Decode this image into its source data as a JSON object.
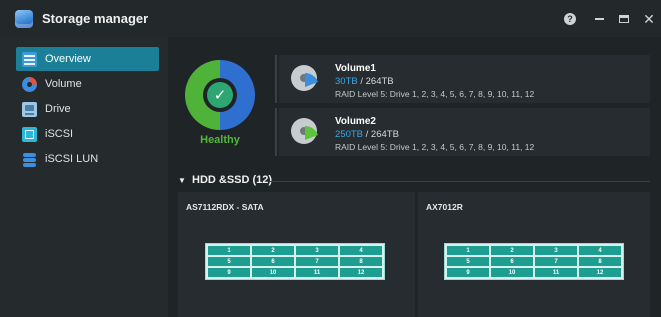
{
  "app": {
    "title": "Storage manager",
    "icon": "storage-app-icon"
  },
  "window_controls": {
    "help_label": "?",
    "close_label": "✕"
  },
  "sidebar": {
    "items": [
      {
        "label": "Overview",
        "icon": "overview-icon",
        "active": true
      },
      {
        "label": "Volume",
        "icon": "volume-icon",
        "active": false
      },
      {
        "label": "Drive",
        "icon": "drive-icon",
        "active": false
      },
      {
        "label": "iSCSI",
        "icon": "iscsi-icon",
        "active": false
      },
      {
        "label": "iSCSI LUN",
        "icon": "iscsi-lun-icon",
        "active": false
      }
    ]
  },
  "status": {
    "label": "Healthy",
    "color": "#50b83c"
  },
  "volumes": [
    {
      "name": "Volume1",
      "used": "30TB",
      "total": " / 264TB",
      "raid": "RAID Level 5: Drive 1, 2, 3, 4, 5, 6, 7, 8, 9, 10, 11, 12",
      "wedge_color": "#3b8de0",
      "used_fraction": 0.11
    },
    {
      "name": "Volume2",
      "used": "250TB",
      "total": " / 264TB",
      "raid": "RAID Level 5: Drive 1, 2, 3, 4, 5, 6, 7, 8, 9, 10, 11, 12",
      "wedge_color": "#5cc43a",
      "used_fraction": 0.95
    }
  ],
  "hdd_section": {
    "title": "HDD &SSD (12)",
    "panels": [
      {
        "title": "AS7112RDX - SATA",
        "slots": [
          "1",
          "2",
          "3",
          "4",
          "5",
          "6",
          "7",
          "8",
          "9",
          "10",
          "11",
          "12"
        ]
      },
      {
        "title": "AX7012R",
        "slots": [
          "1",
          "2",
          "3",
          "4",
          "5",
          "6",
          "7",
          "8",
          "9",
          "10",
          "11",
          "12"
        ]
      }
    ]
  },
  "colors": {
    "accent": "#1a7f97",
    "slot": "#1e9e91",
    "used_capacity": "#3aa8e6"
  }
}
